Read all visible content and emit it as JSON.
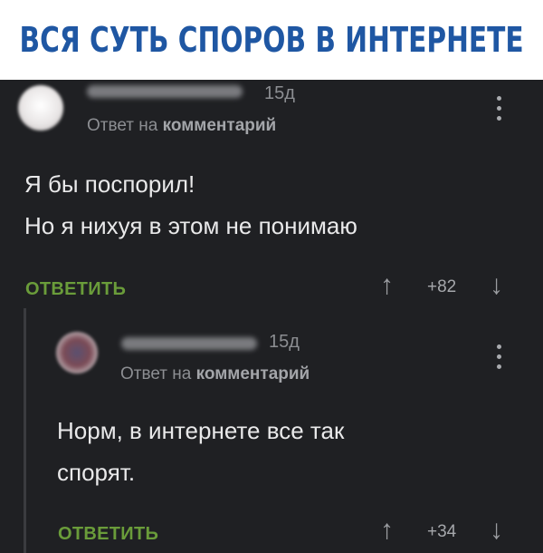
{
  "header": {
    "title": "ВСЯ СУТЬ СПОРОВ В ИНТЕРНЕТЕ"
  },
  "comments": [
    {
      "age": "15д",
      "reply_prefix": "Ответ на",
      "reply_target": "комментарий",
      "lines": [
        "Я бы поспорил!",
        "Но я нихуя в этом не понимаю"
      ],
      "reply_label": "ОТВЕТИТЬ",
      "score": "+82",
      "up_icon": "arrow-up-icon",
      "down_icon": "arrow-down-icon"
    },
    {
      "age": "15д",
      "reply_prefix": "Ответ на",
      "reply_target": "комментарий",
      "lines": [
        "Норм, в интернете все так",
        "спорят."
      ],
      "reply_label": "ОТВЕТИТЬ",
      "score": "+34",
      "up_icon": "arrow-up-icon",
      "down_icon": "arrow-down-icon"
    }
  ],
  "colors": {
    "header_text": "#1f57a3",
    "background": "#1f2023",
    "reply_button": "#6a9c3a",
    "body_text": "#e9e9ea",
    "meta_text": "#8c8e92"
  }
}
